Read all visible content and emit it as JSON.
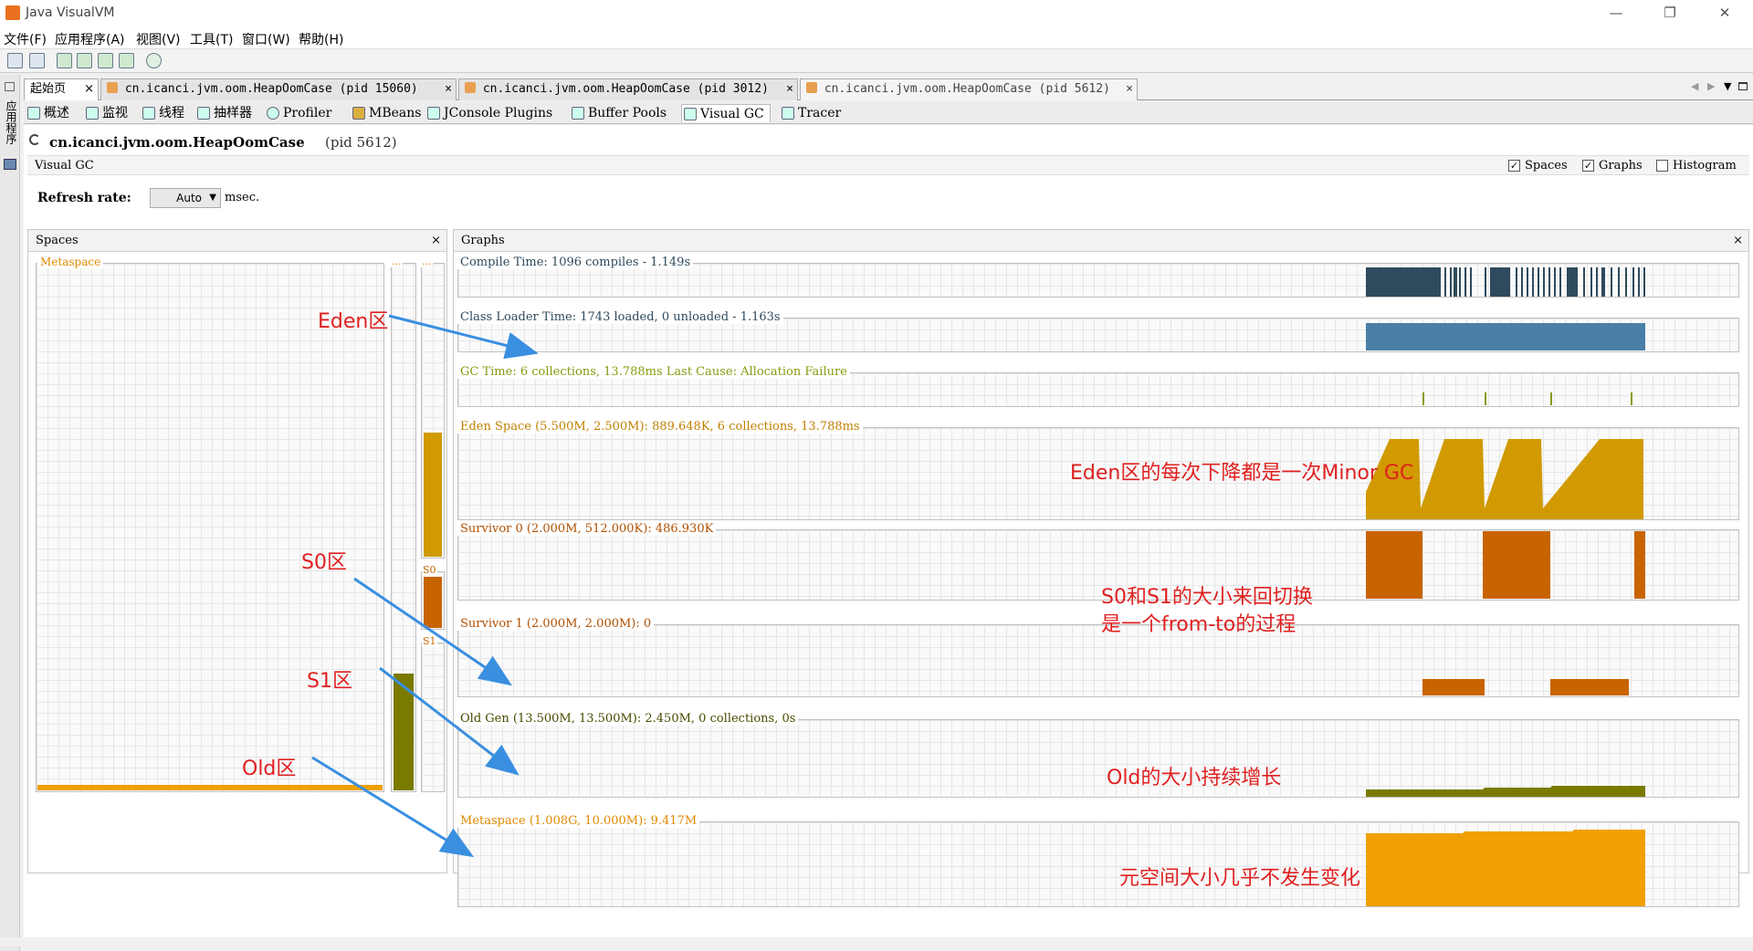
{
  "window": {
    "title": "Java VisualVM",
    "minimize": "—",
    "maximize": "❐",
    "close": "✕"
  },
  "menu": [
    "文件(F)",
    "应用程序(A)",
    "视图(V)",
    "工具(T)",
    "窗口(W)",
    "帮助(H)"
  ],
  "left_strip": "应用程序",
  "doc_tabs": [
    {
      "label": "起始页"
    },
    {
      "label": "cn.icanci.jvm.oom.HeapOomCase (pid 15060)"
    },
    {
      "label": "cn.icanci.jvm.oom.HeapOomCase (pid 3012)"
    },
    {
      "label": "cn.icanci.jvm.oom.HeapOomCase (pid 5612)"
    }
  ],
  "sub_tabs": [
    "概述",
    "监视",
    "线程",
    "抽样器",
    "Profiler",
    "MBeans",
    "JConsole Plugins",
    "Buffer Pools",
    "Visual GC",
    "Tracer"
  ],
  "header": {
    "app_name": "cn.icanci.jvm.oom.HeapOomCase",
    "pid": "(pid 5612)",
    "section": "Visual GC",
    "spaces_label": "Spaces",
    "graphs_label": "Graphs",
    "histogram_label": "Histogram",
    "refresh_label": "Refresh rate:",
    "refresh_value": "Auto",
    "refresh_unit": "msec."
  },
  "spaces_panel": {
    "title": "Spaces",
    "metaspace": "Metaspace",
    "dots": "...",
    "s0": "S0",
    "s1": "S1"
  },
  "graphs_panel": {
    "title": "Graphs",
    "compile": "Compile Time: 1096 compiles - 1.149s",
    "classloader": "Class Loader Time: 1743 loaded, 0 unloaded - 1.163s",
    "gc": "GC Time: 6 collections, 13.788ms Last Cause: Allocation Failure",
    "eden": "Eden Space (5.500M, 2.500M): 889.648K, 6 collections, 13.788ms",
    "survivor0": "Survivor 0 (2.000M, 512.000K): 486.930K",
    "survivor1": "Survivor 1 (2.000M, 2.000M): 0",
    "oldgen": "Old Gen (13.500M, 13.500M): 2.450M, 0 collections, 0s",
    "metaspace": "Metaspace (1.008G, 10.000M): 9.417M"
  },
  "annotations": {
    "eden": "Eden区",
    "s0": "S0区",
    "s1": "S1区",
    "old": "Old区",
    "eden_note": "Eden区的每次下降都是一次Minor GC",
    "survivor_note_1": "S0和S1的大小来回切换",
    "survivor_note_2": "是一个from-to的过程",
    "old_note": "Old的大小持续增长",
    "meta_note": "元空间大小几乎不发生变化"
  },
  "colors": {
    "compile": "#2e4a5c",
    "classloader": "#4a7fa8",
    "gc": "#8a9a10",
    "eden": "#d19a00",
    "survivor": "#c86400",
    "oldgen": "#7a7a00",
    "metaspace": "#f0a000",
    "annotation": "#e02020",
    "arrow": "#3a8fe0"
  }
}
